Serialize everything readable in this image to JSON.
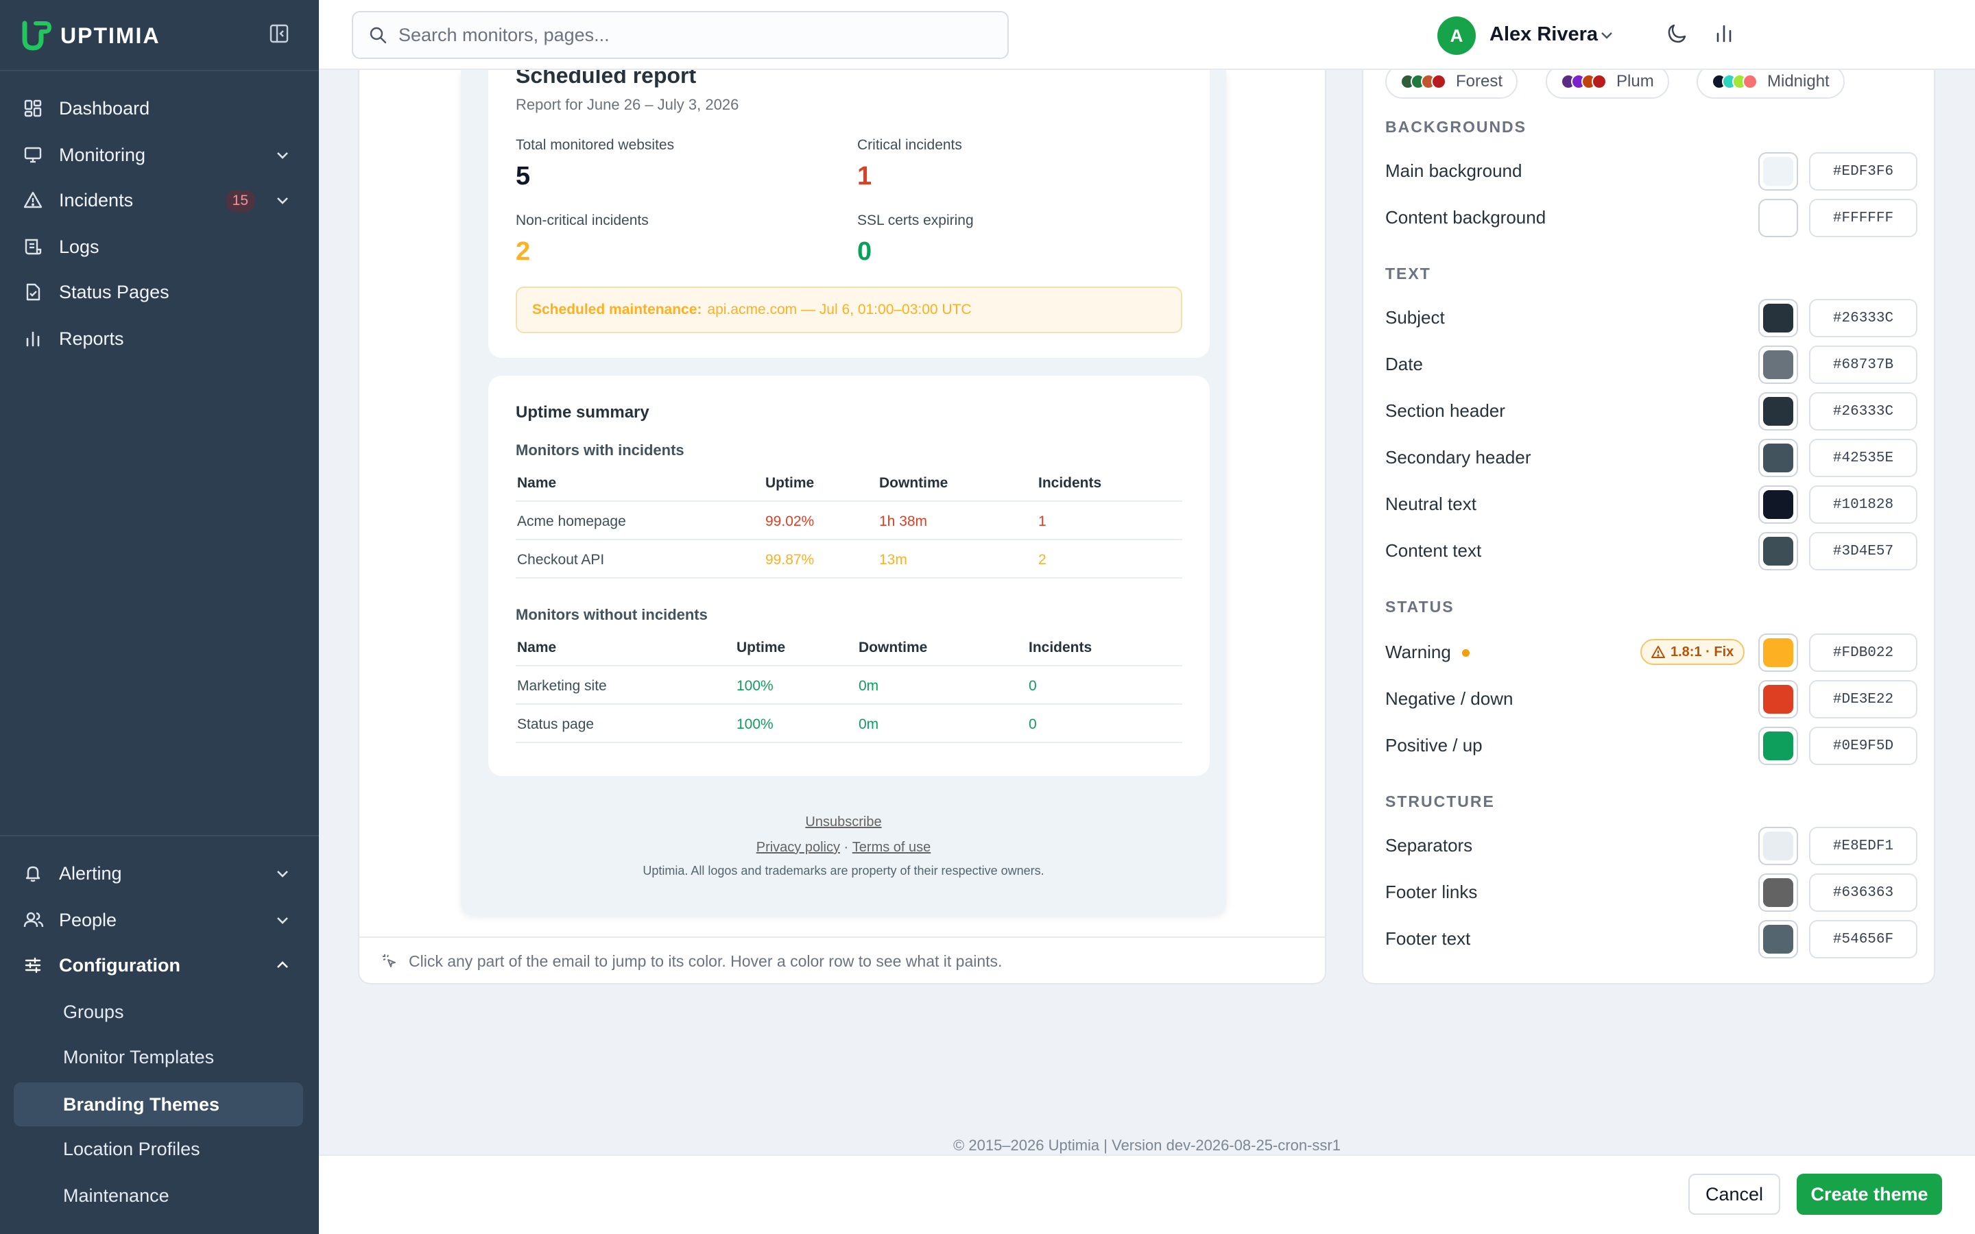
{
  "app": {
    "brand": "UPTIMIA"
  },
  "search": {
    "placeholder": "Search monitors, pages..."
  },
  "user": {
    "initial": "A",
    "name": "Alex Rivera"
  },
  "sidebar": {
    "items": [
      {
        "label": "Dashboard"
      },
      {
        "label": "Monitoring"
      },
      {
        "label": "Incidents",
        "badge": "15"
      },
      {
        "label": "Logs"
      },
      {
        "label": "Status Pages"
      },
      {
        "label": "Reports"
      }
    ],
    "bottom": [
      {
        "label": "Alerting"
      },
      {
        "label": "People"
      },
      {
        "label": "Configuration"
      }
    ],
    "config_sub": [
      {
        "label": "Groups"
      },
      {
        "label": "Monitor Templates"
      },
      {
        "label": "Branding Themes"
      },
      {
        "label": "Location Profiles"
      },
      {
        "label": "Maintenance"
      }
    ]
  },
  "email": {
    "title": "Scheduled report",
    "date_range": "Report for June 26 – July 3, 2026",
    "stats": [
      {
        "label": "Total monitored websites",
        "value": "5"
      },
      {
        "label": "Critical incidents",
        "value": "1"
      },
      {
        "label": "Non-critical incidents",
        "value": "2"
      },
      {
        "label": "SSL certs expiring",
        "value": "0"
      }
    ],
    "maintenance": {
      "label": "Scheduled maintenance:",
      "text": "api.acme.com — Jul 6, 01:00–03:00 UTC"
    },
    "uptime_title": "Uptime summary",
    "with_incidents": {
      "title": "Monitors with incidents",
      "headers": [
        "Name",
        "Uptime",
        "Downtime",
        "Incidents"
      ],
      "rows": [
        [
          "Acme homepage",
          "99.02%",
          "1h 38m",
          "1"
        ],
        [
          "Checkout API",
          "99.87%",
          "13m",
          "2"
        ]
      ]
    },
    "without_incidents": {
      "title": "Monitors without incidents",
      "headers": [
        "Name",
        "Uptime",
        "Downtime",
        "Incidents"
      ],
      "rows": [
        [
          "Marketing site",
          "100%",
          "0m",
          "0"
        ],
        [
          "Status page",
          "100%",
          "0m",
          "0"
        ]
      ]
    },
    "footer": {
      "unsubscribe": "Unsubscribe",
      "privacy": "Privacy policy",
      "sep": " · ",
      "terms": "Terms of use",
      "legal": "Uptimia. All logos and trademarks are property of their respective owners."
    }
  },
  "hint": "Click any part of the email to jump to its color. Hover a color row to see what it paints.",
  "theme": {
    "presets": [
      {
        "name": "Forest",
        "colors": [
          "#2F5D3A",
          "#1F7A3F",
          "#C2562E",
          "#B91C1C"
        ]
      },
      {
        "name": "Plum",
        "colors": [
          "#5B2C83",
          "#7E22CE",
          "#C2410C",
          "#B91C1C"
        ]
      },
      {
        "name": "Midnight",
        "colors": [
          "#0F172A",
          "#2DD4BF",
          "#A3E635",
          "#F87171"
        ]
      }
    ],
    "sections": [
      {
        "title": "BACKGROUNDS",
        "rows": [
          {
            "label": "Main background",
            "hex": "#EDF3F6"
          },
          {
            "label": "Content background",
            "hex": "#FFFFFF"
          }
        ]
      },
      {
        "title": "TEXT",
        "rows": [
          {
            "label": "Subject",
            "hex": "#26333C"
          },
          {
            "label": "Date",
            "hex": "#68737B"
          },
          {
            "label": "Section header",
            "hex": "#26333C"
          },
          {
            "label": "Secondary header",
            "hex": "#42535E"
          },
          {
            "label": "Neutral text",
            "hex": "#101828"
          },
          {
            "label": "Content text",
            "hex": "#3D4E57"
          }
        ]
      },
      {
        "title": "STATUS",
        "rows": [
          {
            "label": "Warning",
            "hex": "#FDB022",
            "contrast": "1.8:1 · Fix"
          },
          {
            "label": "Negative / down",
            "hex": "#DE3E22"
          },
          {
            "label": "Positive / up",
            "hex": "#0E9F5D"
          }
        ]
      },
      {
        "title": "STRUCTURE",
        "rows": [
          {
            "label": "Separators",
            "hex": "#E8EDF1"
          },
          {
            "label": "Footer links",
            "hex": "#636363"
          },
          {
            "label": "Footer text",
            "hex": "#54656F"
          }
        ]
      }
    ]
  },
  "page_footer": "© 2015–2026 Uptimia | Version dev-2026-08-25-cron-ssr1",
  "actions": {
    "cancel": "Cancel",
    "create": "Create theme"
  },
  "colors": {
    "primary": "#16A34A",
    "sidebar": "#2C3E50",
    "warning": "#FDB022",
    "negative": "#DE3E22",
    "positive": "#0E9F5D"
  }
}
